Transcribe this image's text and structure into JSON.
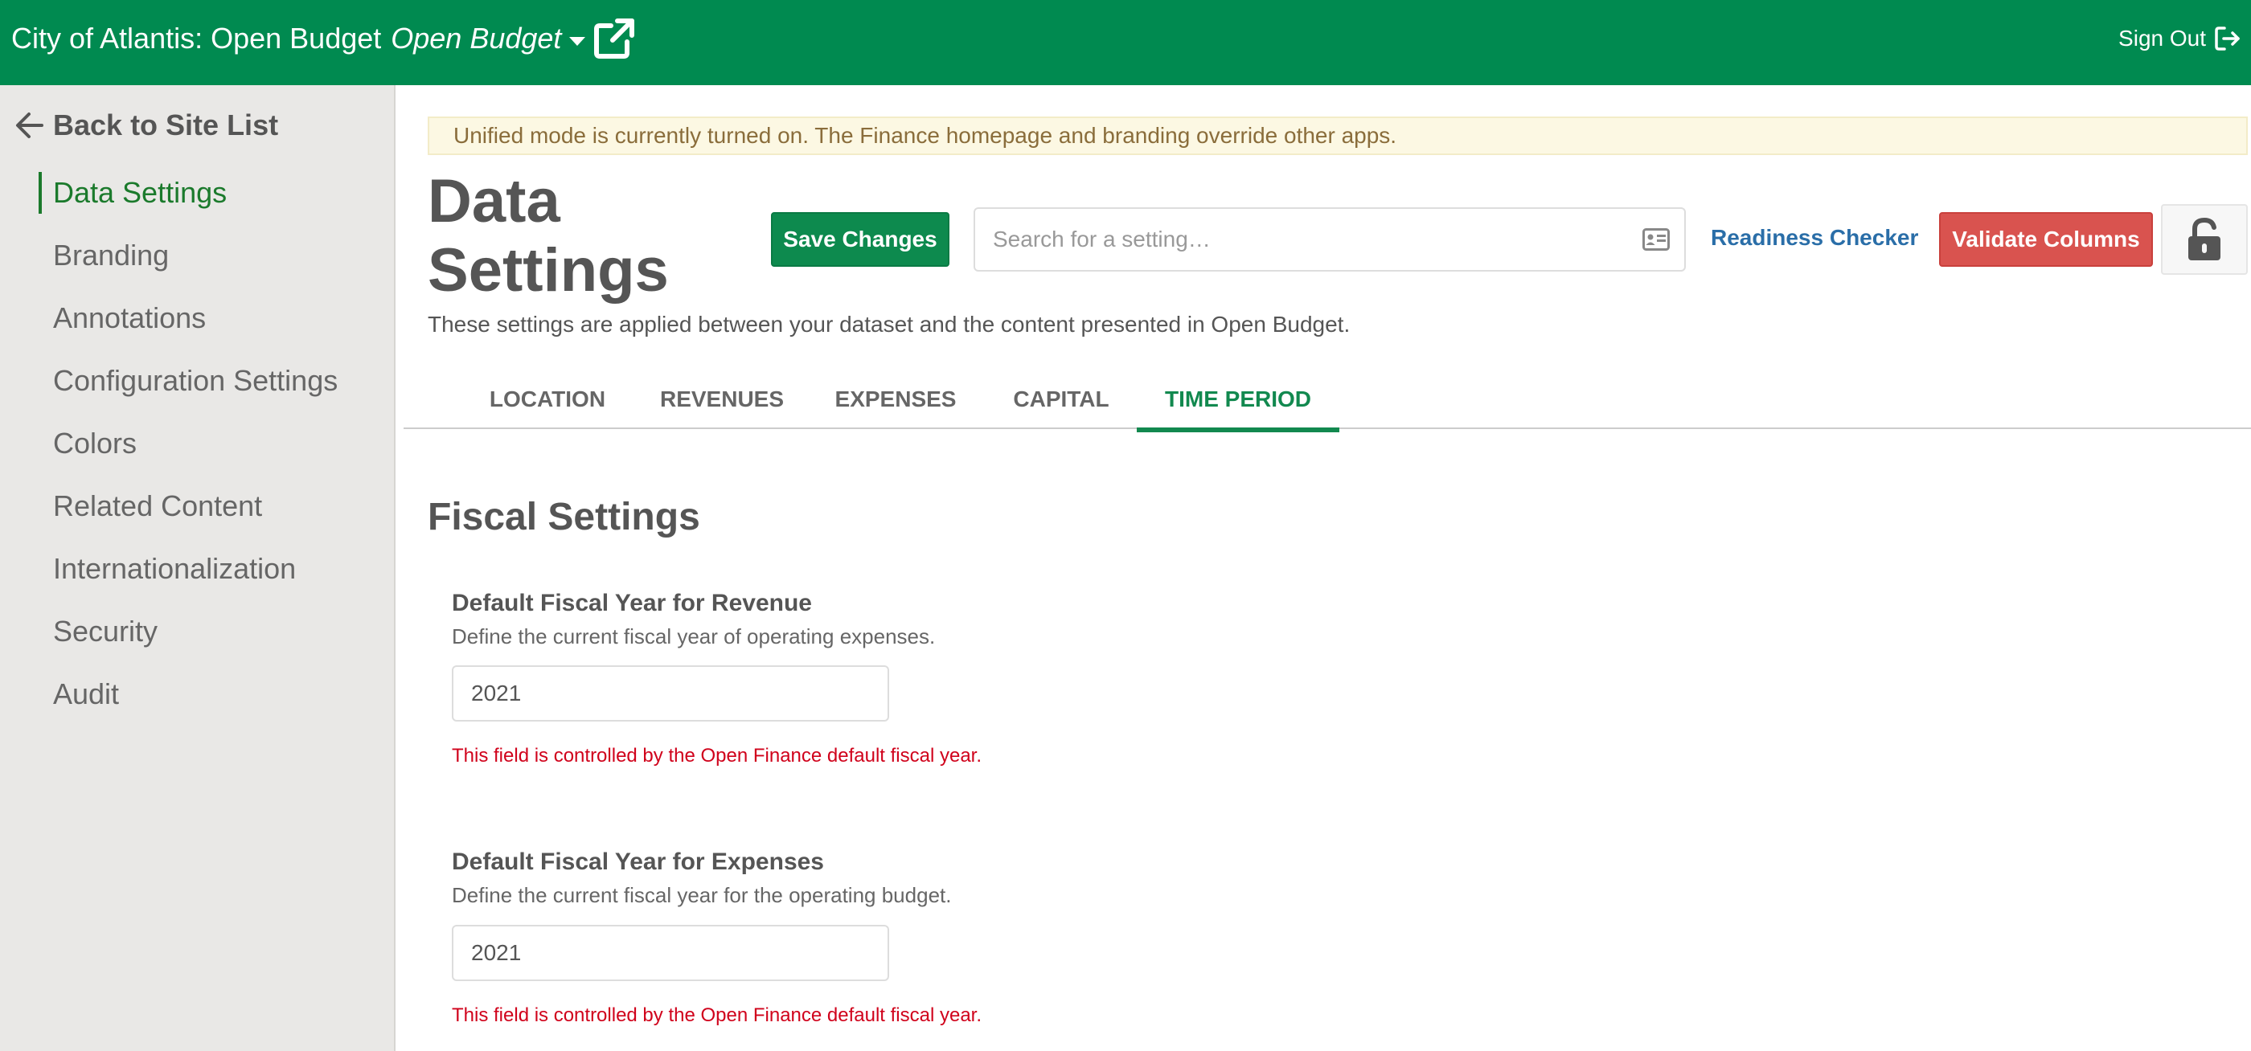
{
  "topbar": {
    "site_title": "City of Atlantis: Open Budget",
    "app_switcher_label": "Open Budget",
    "sign_out_label": "Sign Out"
  },
  "sidebar": {
    "back_label": "Back to Site List",
    "items": [
      {
        "label": "Data Settings",
        "active": true
      },
      {
        "label": "Branding"
      },
      {
        "label": "Annotations"
      },
      {
        "label": "Configuration Settings"
      },
      {
        "label": "Colors"
      },
      {
        "label": "Related Content"
      },
      {
        "label": "Internationalization"
      },
      {
        "label": "Security"
      },
      {
        "label": "Audit"
      }
    ]
  },
  "banner": {
    "text": "Unified mode is currently turned on. The Finance homepage and branding override other apps."
  },
  "header": {
    "title": "Data Settings",
    "save_label": "Save Changes",
    "search_placeholder": "Search for a setting…",
    "readiness_label": "Readiness Checker",
    "validate_label": "Validate Columns",
    "subtitle": "These settings are applied between your dataset and the content presented in Open Budget."
  },
  "tabs": [
    {
      "label": "LOCATION"
    },
    {
      "label": "REVENUES"
    },
    {
      "label": "EXPENSES"
    },
    {
      "label": "CAPITAL"
    },
    {
      "label": "TIME PERIOD",
      "active": true
    }
  ],
  "section": {
    "title": "Fiscal Settings",
    "fields": [
      {
        "label": "Default Fiscal Year for Revenue",
        "help": "Define the current fiscal year of operating expenses.",
        "value": "2021",
        "error": "This field is controlled by the Open Finance default fiscal year."
      },
      {
        "label": "Default Fiscal Year for Expenses",
        "help": "Define the current fiscal year for the operating budget.",
        "value": "2021",
        "error": "This field is controlled by the Open Finance default fiscal year."
      }
    ]
  },
  "colors": {
    "brand_green": "#008a50",
    "active_nav": "#1b7a2c",
    "danger": "#d9534f",
    "link": "#2a6ea8",
    "error_text": "#d0021b"
  },
  "icons": {
    "external": "external-link-icon",
    "sign_out": "sign-out-icon",
    "back": "arrow-left-icon",
    "search": "id-card-icon",
    "lock": "unlock-icon"
  }
}
